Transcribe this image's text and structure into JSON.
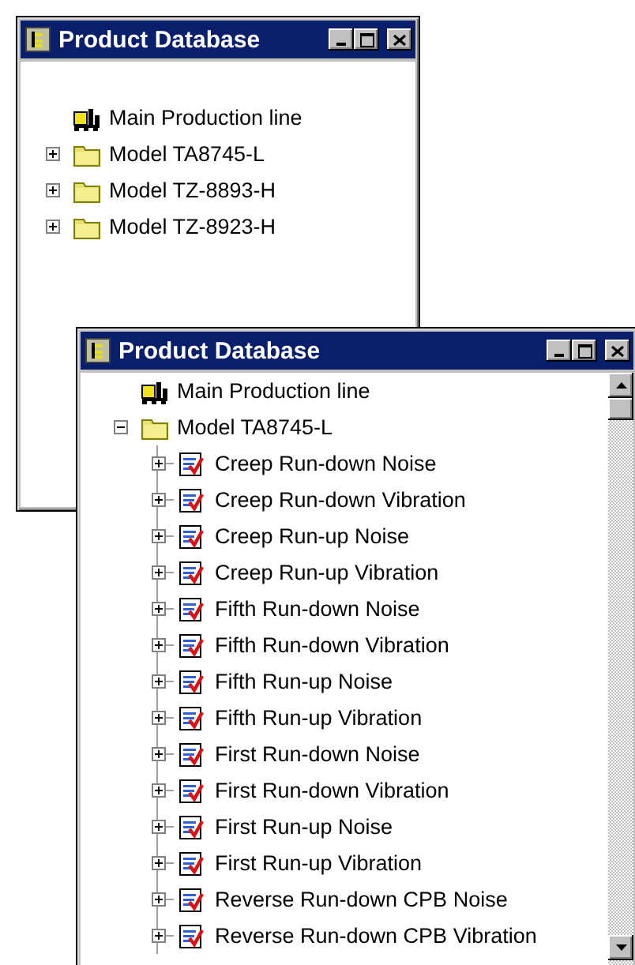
{
  "windows": [
    {
      "title": "Product Database",
      "scrollbar": false,
      "tree": [
        {
          "kind": "line",
          "label": "Main Production line"
        },
        {
          "kind": "folder",
          "label": "Model TA8745-L",
          "expanded": false
        },
        {
          "kind": "folder",
          "label": "Model TZ-8893-H",
          "expanded": false
        },
        {
          "kind": "folder",
          "label": "Model TZ-8923-H",
          "expanded": false
        }
      ]
    },
    {
      "title": "Product Database",
      "scrollbar": true,
      "tree": [
        {
          "kind": "line",
          "label": "Main Production line"
        },
        {
          "kind": "folder",
          "label": "Model TA8745-L",
          "expanded": true,
          "children": [
            {
              "kind": "test",
              "label": "Creep Run-down Noise",
              "expanded": false
            },
            {
              "kind": "test",
              "label": "Creep Run-down Vibration",
              "expanded": false
            },
            {
              "kind": "test",
              "label": "Creep Run-up Noise",
              "expanded": false
            },
            {
              "kind": "test",
              "label": "Creep Run-up Vibration",
              "expanded": false
            },
            {
              "kind": "test",
              "label": "Fifth Run-down Noise",
              "expanded": false
            },
            {
              "kind": "test",
              "label": "Fifth Run-down Vibration",
              "expanded": false
            },
            {
              "kind": "test",
              "label": "Fifth Run-up Noise",
              "expanded": false
            },
            {
              "kind": "test",
              "label": "Fifth Run-up Vibration",
              "expanded": false
            },
            {
              "kind": "test",
              "label": "First Run-down Noise",
              "expanded": false
            },
            {
              "kind": "test",
              "label": "First Run-down Vibration",
              "expanded": false
            },
            {
              "kind": "test",
              "label": "First Run-up Noise",
              "expanded": false
            },
            {
              "kind": "test",
              "label": "First Run-up Vibration",
              "expanded": false
            },
            {
              "kind": "test",
              "label": "Reverse Run-down CPB Noise",
              "expanded": false
            },
            {
              "kind": "test",
              "label": "Reverse Run-down CPB Vibration",
              "expanded": false
            }
          ]
        }
      ]
    }
  ]
}
